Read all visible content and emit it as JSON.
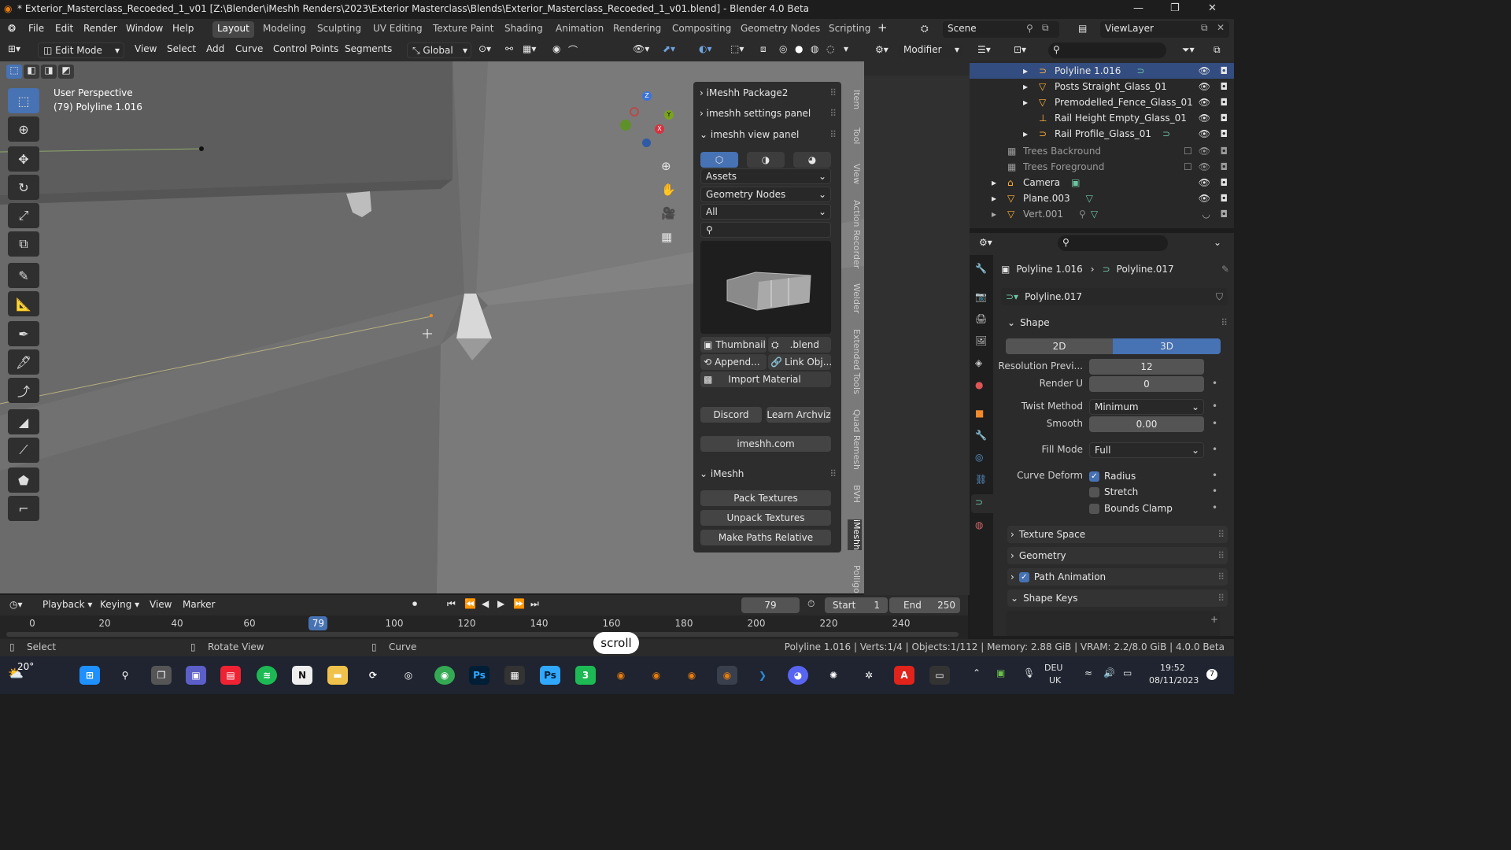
{
  "window": {
    "title": "* Exterior_Masterclass_Recoeded_1_v01 [Z:\\Blender\\iMeshh Renders\\2023\\Exterior Masterclass\\Blends\\Exterior_Masterclass_Recoeded_1_v01.blend] - Blender 4.0 Beta"
  },
  "menu": {
    "file": "File",
    "edit": "Edit",
    "render": "Render",
    "window": "Window",
    "help": "Help"
  },
  "workspaces": [
    "Layout",
    "Modeling",
    "Sculpting",
    "UV Editing",
    "Texture Paint",
    "Shading",
    "Animation",
    "Rendering",
    "Compositing",
    "Geometry Nodes",
    "Scripting"
  ],
  "topright": {
    "scene": "Scene",
    "viewlayer": "ViewLayer"
  },
  "viewport_header": {
    "mode": "Edit Mode",
    "view": "View",
    "select": "Select",
    "add": "Add",
    "curve": "Curve",
    "control_points": "Control Points",
    "segments": "Segments",
    "orientation": "Global"
  },
  "viewport": {
    "perspective": "User Perspective",
    "object_info": "(79) Polyline 1.016",
    "gizmo_x": "X",
    "gizmo_y": "Y",
    "gizmo_z": "Z"
  },
  "props_header": {
    "modifier": "Modifier"
  },
  "npanel": {
    "package": "iMeshh Package2",
    "settings": "imeshh settings panel",
    "view_panel": "imeshh view panel",
    "assets": "Assets",
    "geo_nodes": "Geometry Nodes",
    "filter": "All",
    "thumbnail": "Thumbnail",
    "blend": ".blend",
    "append": "Append...",
    "link": "Link Obj...",
    "import_material": "Import Material",
    "discord": "Discord",
    "learn": "Learn Archviz",
    "site": "imeshh.com",
    "imeshh": "iMeshh",
    "pack": "Pack Textures",
    "unpack": "Unpack Textures",
    "paths": "Make Paths Relative"
  },
  "sidetabs": [
    "Item",
    "Tool",
    "View",
    "Action Recorder",
    "Welder",
    "Extended Tools",
    "Quad Remesh",
    "BVH",
    "iMeshh",
    "Polligo"
  ],
  "outliner": {
    "rows": [
      {
        "label": "Polyline 1.016",
        "selected": true
      },
      {
        "label": "Posts Straight_Glass_01",
        "selected": false
      },
      {
        "label": "Premodelled_Fence_Glass_01",
        "selected": false
      },
      {
        "label": "Rail Height Empty_Glass_01",
        "selected": false
      },
      {
        "label": "Rail Profile_Glass_01",
        "selected": false
      },
      {
        "label": "Trees Backround",
        "selected": false
      },
      {
        "label": "Trees Foreground",
        "selected": false
      },
      {
        "label": "Camera",
        "selected": false
      },
      {
        "label": "Plane.003",
        "selected": false
      },
      {
        "label": "Vert.001",
        "selected": false
      }
    ]
  },
  "properties": {
    "object": "Polyline 1.016",
    "data": "Polyline.017",
    "datablock": "Polyline.017",
    "shape": "Shape",
    "mode_2d": "2D",
    "mode_3d": "3D",
    "res_label": "Resolution Previ...",
    "res_value": "12",
    "render_u_label": "Render U",
    "render_u_value": "0",
    "twist_label": "Twist Method",
    "twist_value": "Minimum",
    "smooth_label": "Smooth",
    "smooth_value": "0.00",
    "fill_label": "Fill Mode",
    "fill_value": "Full",
    "deform_label": "Curve Deform",
    "radius": "Radius",
    "radius_checked": true,
    "stretch": "Stretch",
    "stretch_checked": false,
    "bounds": "Bounds Clamp",
    "bounds_checked": false,
    "texture_space": "Texture Space",
    "geometry": "Geometry",
    "path_animation": "Path Animation",
    "path_animation_checked": true,
    "shape_keys": "Shape Keys"
  },
  "timeline": {
    "playback": "Playback",
    "keying": "Keying",
    "view": "View",
    "marker": "Marker",
    "current": "79",
    "start_label": "Start",
    "start": "1",
    "end_label": "End",
    "end": "250",
    "ticks": [
      "0",
      "20",
      "40",
      "60",
      "79",
      "100",
      "120",
      "140",
      "160",
      "180",
      "200",
      "220",
      "240"
    ],
    "playhead_frame": 79
  },
  "statusbar": {
    "select": "Select",
    "rotate": "Rotate View",
    "curve": "Curve",
    "stats": "Polyline 1.016 | Verts:1/4 | Objects:1/112 | Memory: 2.88 GiB | VRAM: 2.2/8.0 GiB | 4.0.0 Beta"
  },
  "overlay": {
    "scroll": "scroll"
  },
  "taskbar": {
    "weather": "20°",
    "lang": "DEU",
    "region": "UK",
    "time": "19:52",
    "date": "08/11/2023",
    "notif": "7"
  }
}
